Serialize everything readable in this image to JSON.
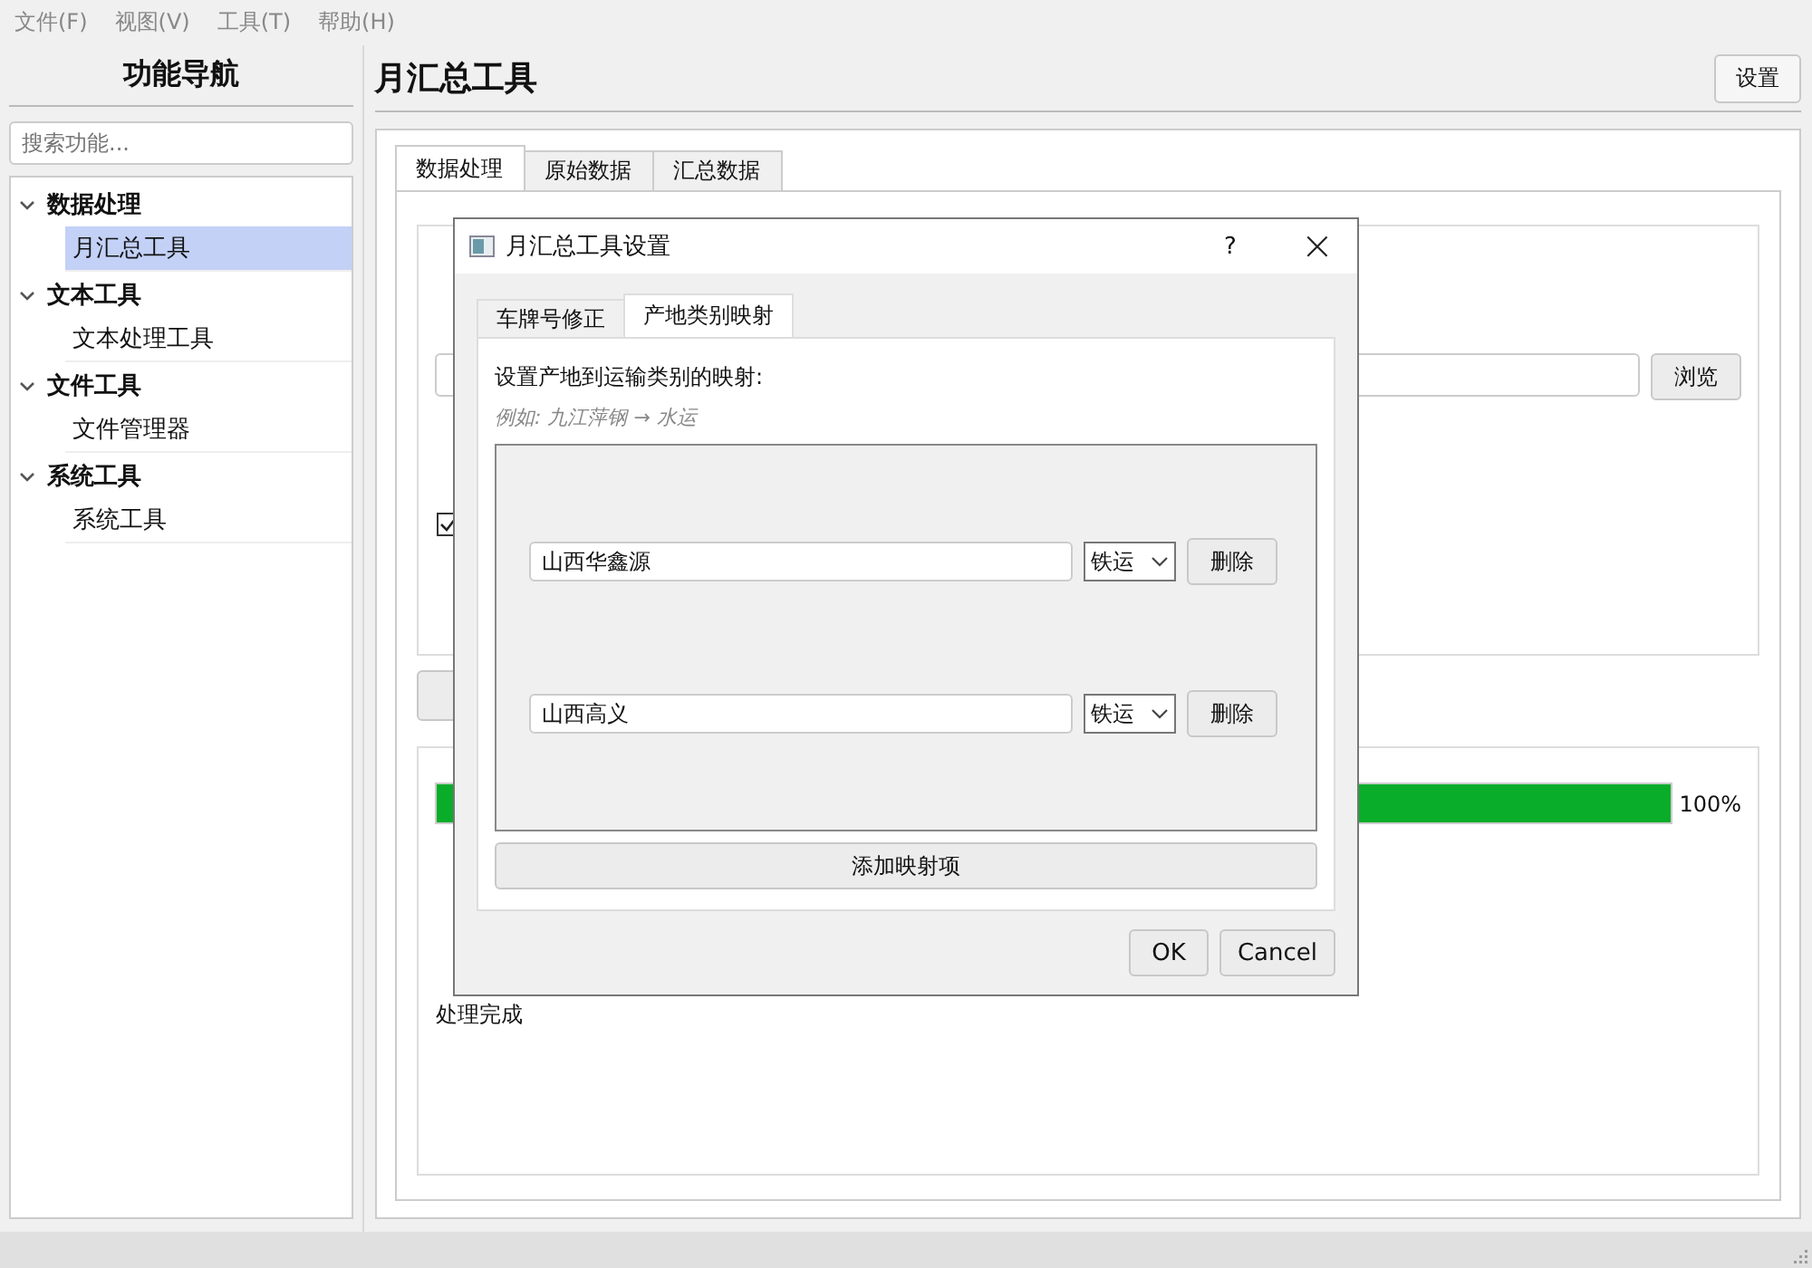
{
  "menu_bar": [
    "文件(F)",
    "视图(V)",
    "工具(T)",
    "帮助(H)"
  ],
  "sidebar": {
    "title": "功能导航",
    "search": {
      "placeholder": "搜索功能..."
    },
    "tree": [
      {
        "label": "数据处理",
        "expanded": true,
        "children": [
          {
            "label": "月汇总工具",
            "selected": true
          }
        ]
      },
      {
        "label": "文本工具",
        "expanded": true,
        "children": [
          {
            "label": "文本处理工具",
            "selected": false
          }
        ]
      },
      {
        "label": "文件工具",
        "expanded": true,
        "children": [
          {
            "label": "文件管理器",
            "selected": false
          }
        ]
      },
      {
        "label": "系统工具",
        "expanded": true,
        "children": [
          {
            "label": "系统工具",
            "selected": false
          }
        ]
      }
    ]
  },
  "header": {
    "title": "月汇总工具",
    "settings_button": "设置"
  },
  "tabs": [
    {
      "label": "数据处理",
      "selected": true
    },
    {
      "label": "原始数据",
      "selected": false
    },
    {
      "label": "汇总数据",
      "selected": false
    }
  ],
  "data_group": {
    "browse_button": "浏览",
    "checkbox": {
      "checked": true
    }
  },
  "progress_group": {
    "level": 1,
    "reading": "100%",
    "status": "处理完成"
  },
  "dialog": {
    "title": "月汇总工具设置",
    "help": "?",
    "close": "×",
    "tabs": [
      {
        "label": "车牌号修正",
        "selected": false
      },
      {
        "label": "产地类别映射",
        "selected": true
      }
    ],
    "heading": "设置产地到运输类别的映射:",
    "example": "例如: 九江萍钢 → 水运",
    "mappings": [
      {
        "origin": "山西华鑫源",
        "category": "铁运",
        "delete": "删除"
      },
      {
        "origin": "山西高义",
        "category": "铁运",
        "delete": "删除"
      }
    ],
    "add_button": "添加映射项",
    "buttons": [
      "OK",
      "Cancel"
    ]
  }
}
